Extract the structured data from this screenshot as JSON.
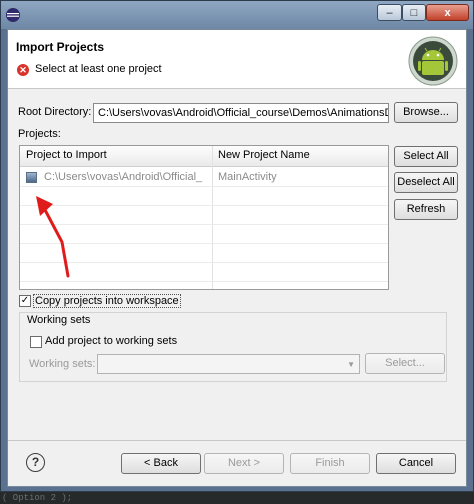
{
  "titlebar": {
    "minimize": "–",
    "maximize": "□",
    "close": "x"
  },
  "header": {
    "title": "Import Projects",
    "message": "Select at least one project"
  },
  "root": {
    "label": "Root Directory:",
    "value": "C:\\Users\\vovas\\Android\\Official_course\\Demos\\AnimationsD",
    "browse_label": "Browse..."
  },
  "projects": {
    "label": "Projects:",
    "columns": [
      "Project to Import",
      "New Project Name"
    ],
    "rows": [
      {
        "path": "C:\\Users\\vovas\\Android\\Official_",
        "name": "MainActivity"
      }
    ],
    "select_all": "Select All",
    "deselect_all": "Deselect All",
    "refresh": "Refresh"
  },
  "copy_into_workspace": {
    "label": "Copy projects into workspace",
    "checked": true
  },
  "working_sets": {
    "group_label": "Working sets",
    "add_label": "Add project to working sets",
    "add_checked": false,
    "field_label": "Working sets:",
    "value": "",
    "select_label": "Select..."
  },
  "footer": {
    "back": "< Back",
    "next": "Next >",
    "finish": "Finish",
    "cancel": "Cancel"
  },
  "background_code": "( Option 2 );"
}
